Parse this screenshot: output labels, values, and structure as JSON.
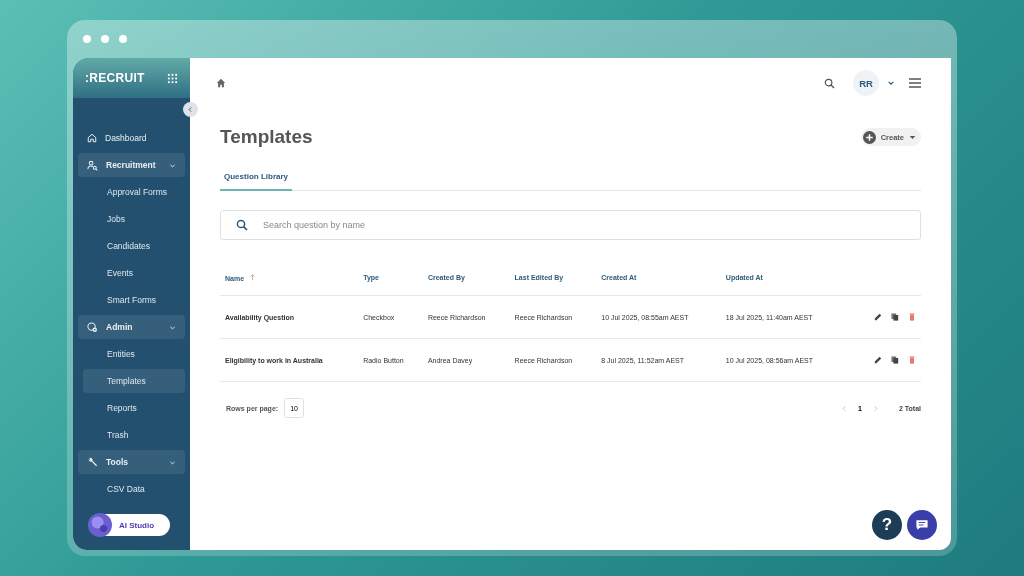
{
  "app": {
    "logo": ":RECRUIT"
  },
  "nav": [
    {
      "kind": "link",
      "label": "Dashboard",
      "selected": false
    },
    {
      "kind": "group",
      "label": "Recruitment",
      "expanded": true,
      "children": [
        {
          "label": "Approval Forms",
          "selected": false
        },
        {
          "label": "Jobs",
          "selected": false
        },
        {
          "label": "Candidates",
          "selected": false
        },
        {
          "label": "Events",
          "selected": false
        },
        {
          "label": "Smart Forms",
          "selected": false
        }
      ]
    },
    {
      "kind": "group",
      "label": "Admin",
      "expanded": true,
      "children": [
        {
          "label": "Entities",
          "selected": false
        },
        {
          "label": "Templates",
          "selected": true
        },
        {
          "label": "Reports",
          "selected": false
        },
        {
          "label": "Trash",
          "selected": false
        }
      ]
    },
    {
      "kind": "group",
      "label": "Tools",
      "expanded": true,
      "children": [
        {
          "label": "CSV Data",
          "selected": false
        }
      ]
    }
  ],
  "ai_studio": {
    "label": "AI Studio"
  },
  "topbar": {
    "avatar": "RR"
  },
  "page": {
    "title": "Templates",
    "create": "Create"
  },
  "tabs": [
    {
      "label": "Question Library",
      "selected": true
    }
  ],
  "search": {
    "placeholder": "Search question by name"
  },
  "table": {
    "columns": [
      {
        "label": "Name",
        "sorted": true
      },
      {
        "label": "Type",
        "sorted": false
      },
      {
        "label": "Created By",
        "sorted": false
      },
      {
        "label": "Last Edited By",
        "sorted": false
      },
      {
        "label": "Created At",
        "sorted": false
      },
      {
        "label": "Updated At",
        "sorted": false
      }
    ],
    "rows": [
      {
        "cells": [
          "Availability Question",
          "Checkbox",
          "Reece Richardson",
          "Reece Richardson",
          "10 Jul 2025, 08:55am AEST",
          "18 Jul 2025, 11:40am AEST"
        ]
      },
      {
        "cells": [
          "Eligibility to work in Australia",
          "Radio Button",
          "Andrea Davey",
          "Reece Richardson",
          "8 Jul 2025, 11:52am AEST",
          "10 Jul 2025, 08:56am AEST"
        ]
      }
    ]
  },
  "pagination": {
    "rows_label": "Rows per page:",
    "rows_value": "10",
    "page": "1",
    "total": "2 Total"
  },
  "help": {
    "label": "?"
  }
}
